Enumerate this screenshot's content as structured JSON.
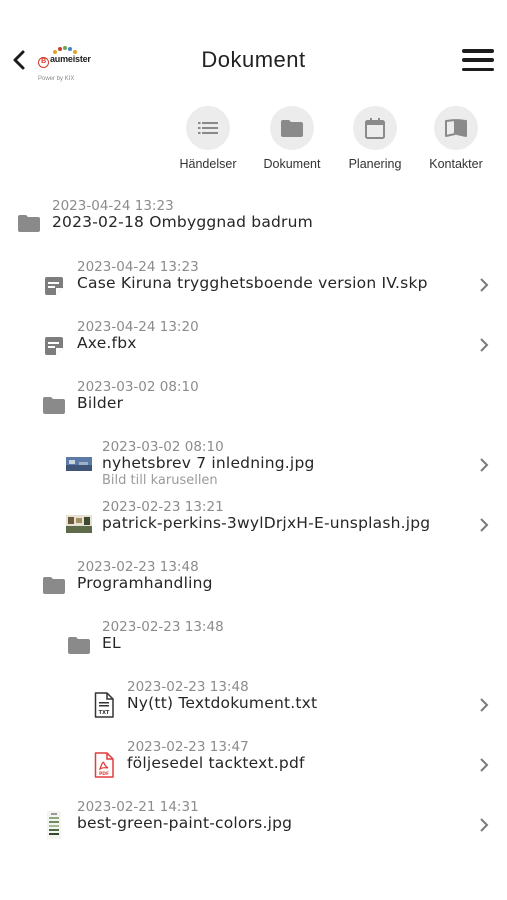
{
  "header": {
    "title": "Dokument",
    "logo_text": "aumeister",
    "logo_letter": "B",
    "powered_by": "Power by KIX"
  },
  "nav": [
    {
      "label": "Händelser",
      "icon": "list-icon"
    },
    {
      "label": "Dokument",
      "icon": "folder-icon"
    },
    {
      "label": "Planering",
      "icon": "calendar-icon"
    },
    {
      "label": "Kontakter",
      "icon": "book-icon"
    }
  ],
  "items": [
    {
      "time": "2023-04-24 13:23",
      "name": "2023-02-18 Ombyggnad badrum",
      "icon": "folder-icon",
      "level": 0,
      "chevron": false
    },
    {
      "time": "2023-04-24 13:23",
      "name": "Case Kiruna trygghetsboende version IV.skp",
      "icon": "note-icon",
      "level": 1,
      "chevron": true
    },
    {
      "time": "2023-04-24 13:20",
      "name": "Axe.fbx",
      "icon": "note-icon",
      "level": 1,
      "chevron": true
    },
    {
      "time": "2023-03-02 08:10",
      "name": "Bilder",
      "icon": "folder-icon",
      "level": 1,
      "chevron": false
    },
    {
      "time": "2023-03-02 08:10",
      "name": "nyhetsbrev 7 inledning.jpg",
      "sub": "Bild till karusellen",
      "icon": "image-thumbnail-icon",
      "level": 2,
      "chevron": true
    },
    {
      "time": "2023-02-23 13:21",
      "name": "patrick-perkins-3wylDrjxH-E-unsplash.jpg",
      "icon": "image-thumbnail-icon",
      "level": 2,
      "chevron": true
    },
    {
      "time": "2023-02-23 13:48",
      "name": "Programhandling",
      "icon": "folder-icon",
      "level": 1,
      "chevron": false
    },
    {
      "time": "2023-02-23 13:48",
      "name": "EL",
      "icon": "folder-icon",
      "level": 2,
      "chevron": false
    },
    {
      "time": "2023-02-23 13:48",
      "name": "Ny(tt) Textdokument.txt",
      "icon": "txt-file-icon",
      "level": 3,
      "chevron": true
    },
    {
      "time": "2023-02-23 13:47",
      "name": "följesedel tacktext.pdf",
      "icon": "pdf-file-icon",
      "level": 3,
      "chevron": true
    },
    {
      "time": "2023-02-21 14:31",
      "name": "best-green-paint-colors.jpg",
      "icon": "image-thumbnail-icon",
      "level": 1,
      "chevron": true
    }
  ],
  "colors": {
    "folder": "#8a8a8a",
    "text": "#262626",
    "muted": "#8c8c8c",
    "pdf": "#e23b3b",
    "nav_circle": "#ececec"
  }
}
